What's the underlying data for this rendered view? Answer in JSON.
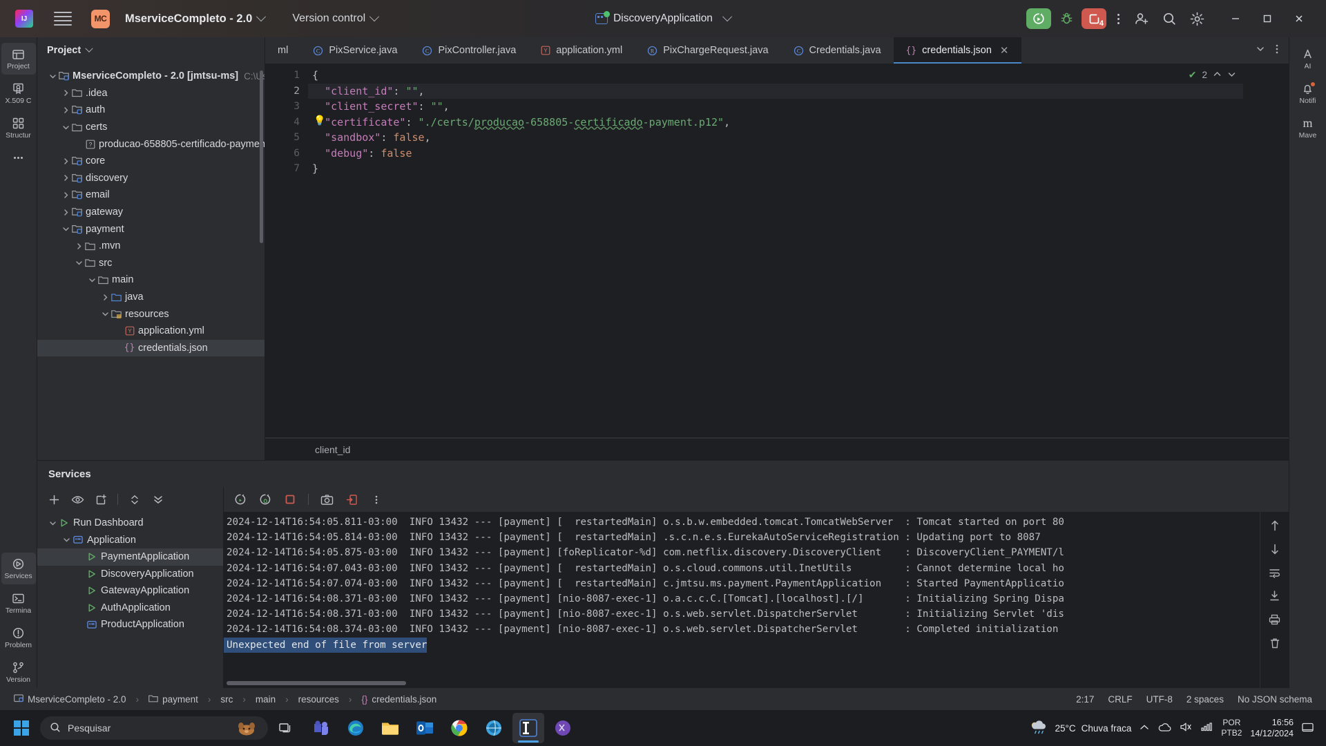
{
  "titlebar": {
    "project_badge": "MC",
    "project_name": "MserviceCompleto - 2.0",
    "version_control": "Version control",
    "run_config": "DiscoveryApplication",
    "stop_count": "4"
  },
  "project_panel": {
    "header": "Project",
    "tree": [
      {
        "label": "MserviceCompleto - 2.0 [jmtsu-ms]",
        "suffix": "C:\\Use",
        "indent": 0,
        "twist": "down",
        "icon": "module-folder",
        "bold": true
      },
      {
        "label": ".idea",
        "indent": 1,
        "twist": "right",
        "icon": "folder"
      },
      {
        "label": "auth",
        "indent": 1,
        "twist": "right",
        "icon": "module-folder"
      },
      {
        "label": "certs",
        "indent": 1,
        "twist": "down",
        "icon": "folder"
      },
      {
        "label": "producao-658805-certificado-paymen",
        "indent": 2,
        "twist": "none",
        "icon": "unknown-file"
      },
      {
        "label": "core",
        "indent": 1,
        "twist": "right",
        "icon": "module-folder"
      },
      {
        "label": "discovery",
        "indent": 1,
        "twist": "right",
        "icon": "module-folder"
      },
      {
        "label": "email",
        "indent": 1,
        "twist": "right",
        "icon": "module-folder"
      },
      {
        "label": "gateway",
        "indent": 1,
        "twist": "right",
        "icon": "module-folder"
      },
      {
        "label": "payment",
        "indent": 1,
        "twist": "down",
        "icon": "module-folder"
      },
      {
        "label": ".mvn",
        "indent": 2,
        "twist": "right",
        "icon": "folder"
      },
      {
        "label": "src",
        "indent": 2,
        "twist": "down",
        "icon": "folder"
      },
      {
        "label": "main",
        "indent": 3,
        "twist": "down",
        "icon": "folder"
      },
      {
        "label": "java",
        "indent": 4,
        "twist": "right",
        "icon": "source-folder"
      },
      {
        "label": "resources",
        "indent": 4,
        "twist": "down",
        "icon": "resource-folder"
      },
      {
        "label": "application.yml",
        "indent": 5,
        "twist": "none",
        "icon": "yaml-file"
      },
      {
        "label": "credentials.json",
        "indent": 5,
        "twist": "none",
        "icon": "json-file",
        "selected": true
      }
    ]
  },
  "editor": {
    "tabs": [
      {
        "label": "ml",
        "icon": "yaml-file",
        "truncated": true
      },
      {
        "label": "PixService.java",
        "icon": "class-file"
      },
      {
        "label": "PixController.java",
        "icon": "class-file"
      },
      {
        "label": "application.yml",
        "icon": "yaml-file"
      },
      {
        "label": "PixChargeRequest.java",
        "icon": "record-file"
      },
      {
        "label": "Credentials.java",
        "icon": "class-file"
      },
      {
        "label": "credentials.json",
        "icon": "json-file",
        "active": true,
        "closable": true
      }
    ],
    "inspection_count": "2",
    "gutter_lines": [
      "1",
      "2",
      "3",
      "4",
      "5",
      "6",
      "7"
    ],
    "current_line": 2,
    "code_lines": [
      [
        {
          "t": "{",
          "c": "k-brace"
        }
      ],
      [
        {
          "t": "  ",
          "c": "k-punct"
        },
        {
          "t": "\"client_id\"",
          "c": "k-key"
        },
        {
          "t": ": ",
          "c": "k-punct"
        },
        {
          "t": "\"\"",
          "c": "k-str"
        },
        {
          "t": ",",
          "c": "k-punct"
        }
      ],
      [
        {
          "t": "  ",
          "c": "k-punct"
        },
        {
          "t": "\"client_secret\"",
          "c": "k-key"
        },
        {
          "t": ": ",
          "c": "k-punct"
        },
        {
          "t": "\"\"",
          "c": "k-str"
        },
        {
          "t": ",",
          "c": "k-punct"
        }
      ],
      [
        {
          "t": "  ",
          "c": "k-punct"
        },
        {
          "t": "\"certificate\"",
          "c": "k-key"
        },
        {
          "t": ": ",
          "c": "k-punct"
        },
        {
          "t": "\"./certs/",
          "c": "k-str"
        },
        {
          "t": "producao",
          "c": "k-str squig"
        },
        {
          "t": "-658805-",
          "c": "k-str"
        },
        {
          "t": "certificado",
          "c": "k-str squig"
        },
        {
          "t": "-payment.p12\"",
          "c": "k-str"
        },
        {
          "t": ",",
          "c": "k-punct"
        }
      ],
      [
        {
          "t": "  ",
          "c": "k-punct"
        },
        {
          "t": "\"sandbox\"",
          "c": "k-key"
        },
        {
          "t": ": ",
          "c": "k-punct"
        },
        {
          "t": "false",
          "c": "k-kw"
        },
        {
          "t": ",",
          "c": "k-punct"
        }
      ],
      [
        {
          "t": "  ",
          "c": "k-punct"
        },
        {
          "t": "\"debug\"",
          "c": "k-key"
        },
        {
          "t": ": ",
          "c": "k-punct"
        },
        {
          "t": "false",
          "c": "k-kw"
        }
      ],
      [
        {
          "t": "}",
          "c": "k-brace"
        }
      ]
    ],
    "breadcrumb": "client_id"
  },
  "services": {
    "title": "Services",
    "tree": [
      {
        "label": "Run Dashboard",
        "indent": 0,
        "twist": "down",
        "icon": "run-green"
      },
      {
        "label": "Application",
        "indent": 1,
        "twist": "down",
        "icon": "application-blue"
      },
      {
        "label": "PaymentApplication",
        "indent": 2,
        "twist": "none",
        "icon": "run-green",
        "selected": true
      },
      {
        "label": "DiscoveryApplication",
        "indent": 2,
        "twist": "none",
        "icon": "run-green"
      },
      {
        "label": "GatewayApplication",
        "indent": 2,
        "twist": "none",
        "icon": "run-green"
      },
      {
        "label": "AuthApplication",
        "indent": 2,
        "twist": "none",
        "icon": "run-green"
      },
      {
        "label": "ProductApplication",
        "indent": 2,
        "twist": "none",
        "icon": "application-blue"
      }
    ],
    "log_lines": [
      "2024-12-14T16:54:05.811-03:00  INFO 13432 --- [payment] [  restartedMain] o.s.b.w.embedded.tomcat.TomcatWebServer  : Tomcat started on port 80",
      "2024-12-14T16:54:05.814-03:00  INFO 13432 --- [payment] [  restartedMain] .s.c.n.e.s.EurekaAutoServiceRegistration : Updating port to 8087",
      "2024-12-14T16:54:05.875-03:00  INFO 13432 --- [payment] [foReplicator-%d] com.netflix.discovery.DiscoveryClient    : DiscoveryClient_PAYMENT/l",
      "2024-12-14T16:54:07.043-03:00  INFO 13432 --- [payment] [  restartedMain] o.s.cloud.commons.util.InetUtils         : Cannot determine local ho",
      "2024-12-14T16:54:07.074-03:00  INFO 13432 --- [payment] [  restartedMain] c.jmtsu.ms.payment.PaymentApplication    : Started PaymentApplicatio",
      "2024-12-14T16:54:08.371-03:00  INFO 13432 --- [payment] [nio-8087-exec-1] o.a.c.c.C.[Tomcat].[localhost].[/]       : Initializing Spring Dispa",
      "2024-12-14T16:54:08.371-03:00  INFO 13432 --- [payment] [nio-8087-exec-1] o.s.web.servlet.DispatcherServlet        : Initializing Servlet 'dis",
      "2024-12-14T16:54:08.374-03:00  INFO 13432 --- [payment] [nio-8087-exec-1] o.s.web.servlet.DispatcherServlet        : Completed initialization"
    ],
    "error_line": "Unexpected end of file from server"
  },
  "statusbar": {
    "project": "MserviceCompleto - 2.0",
    "path": [
      "payment",
      "src",
      "main",
      "resources",
      "credentials.json"
    ],
    "caret": "2:17",
    "line_sep": "CRLF",
    "encoding": "UTF-8",
    "indent": "2 spaces",
    "schema": "No JSON schema"
  },
  "left_rail": [
    {
      "label": "Project",
      "icon": "project-icon",
      "active": true
    },
    {
      "label": "X.509 C",
      "icon": "certificate-icon"
    },
    {
      "label": "Structur",
      "icon": "structure-icon"
    },
    {
      "label": "more",
      "icon": "more-icon"
    }
  ],
  "left_rail_bottom": [
    {
      "label": "Services",
      "icon": "services-icon",
      "active": true
    },
    {
      "label": "Termina",
      "icon": "terminal-icon"
    },
    {
      "label": "Problem",
      "icon": "problems-icon"
    },
    {
      "label": "Version",
      "icon": "version-control-icon"
    }
  ],
  "right_rail": [
    {
      "label": "AI",
      "icon": "ai-assistant-icon"
    },
    {
      "label": "Notifi",
      "icon": "notifications-icon"
    },
    {
      "label": "Mave",
      "icon": "maven-icon"
    }
  ],
  "taskbar": {
    "search_placeholder": "Pesquisar",
    "weather_temp": "25°C",
    "weather_desc": "Chuva fraca",
    "lang_1": "POR",
    "lang_2": "PTB2",
    "time": "16:56",
    "date": "14/12/2024"
  }
}
